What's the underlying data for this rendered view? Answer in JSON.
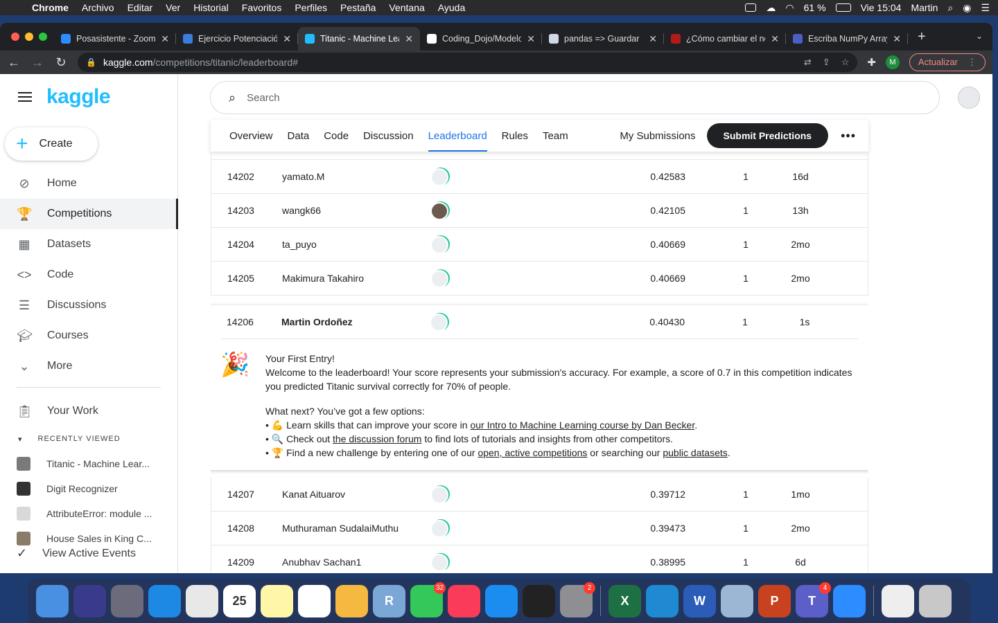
{
  "menubar": {
    "app": "Chrome",
    "items": [
      "Archivo",
      "Editar",
      "Ver",
      "Historial",
      "Favoritos",
      "Perfiles",
      "Pestaña",
      "Ventana",
      "Ayuda"
    ],
    "battery": "61 %",
    "clock": "Vie 15:04",
    "user": "Martin"
  },
  "browser": {
    "tabs": [
      {
        "title": "Posasistente - Zoom",
        "color": "#2d8cff"
      },
      {
        "title": "Ejercicio Potenciación",
        "color": "#3b7ddd"
      },
      {
        "title": "Titanic - Machine Learning",
        "color": "#20beff"
      },
      {
        "title": "Coding_Dojo/Modelos",
        "color": "#ffffff"
      },
      {
        "title": "pandas => Guardar",
        "color": "#d0d7e5"
      },
      {
        "title": "¿Cómo cambiar el nombre",
        "color": "#b31b1b"
      },
      {
        "title": "Escriba NumPy Array",
        "color": "#4a5fc1"
      }
    ],
    "active_tab": 2,
    "url_host": "kaggle.com",
    "url_path": "/competitions/titanic/leaderboard#",
    "profile_initial": "M",
    "update_label": "Actualizar"
  },
  "sidebar": {
    "logo": "kaggle",
    "create": "Create",
    "nav": [
      {
        "label": "Home",
        "icon": "compass-icon"
      },
      {
        "label": "Competitions",
        "icon": "trophy-icon"
      },
      {
        "label": "Datasets",
        "icon": "table-icon"
      },
      {
        "label": "Code",
        "icon": "code-icon"
      },
      {
        "label": "Discussions",
        "icon": "comments-icon"
      },
      {
        "label": "Courses",
        "icon": "school-icon"
      },
      {
        "label": "More",
        "icon": "chevron-down-icon"
      }
    ],
    "your_work": "Your Work",
    "recently_viewed": "RECENTLY VIEWED",
    "recent": [
      {
        "label": "Titanic - Machine Lear...",
        "color": "#7a7a7a"
      },
      {
        "label": "Digit Recognizer",
        "color": "#333333"
      },
      {
        "label": "AttributeError: module ...",
        "color": "#d9d9d9"
      },
      {
        "label": "House Sales in King C...",
        "color": "#8a7b6a"
      }
    ],
    "view_active_events": "View Active Events"
  },
  "main": {
    "search_placeholder": "Search",
    "tabs": [
      "Overview",
      "Data",
      "Code",
      "Discussion",
      "Leaderboard",
      "Rules",
      "Team"
    ],
    "active_tab": "Leaderboard",
    "my_submissions": "My Submissions",
    "submit": "Submit Predictions",
    "rows_before": [
      {
        "rank": "14202",
        "name": "yamato.M",
        "score": "0.42583",
        "entries": "1",
        "last": "16d",
        "photo": false
      },
      {
        "rank": "14203",
        "name": "wangk66",
        "score": "0.42105",
        "entries": "1",
        "last": "13h",
        "photo": true
      },
      {
        "rank": "14204",
        "name": "ta_puyo",
        "score": "0.40669",
        "entries": "1",
        "last": "2mo",
        "photo": false
      },
      {
        "rank": "14205",
        "name": "Makimura Takahiro",
        "score": "0.40669",
        "entries": "1",
        "last": "2mo",
        "photo": false
      }
    ],
    "you": {
      "rank": "14206",
      "name": "Martin Ordoñez",
      "score": "0.40430",
      "entries": "1",
      "last": "1s",
      "title": "Your First Entry!",
      "welcome": "Welcome to the leaderboard! Your score represents your submission's accuracy. For example, a score of 0.7 in this competition indicates you predicted Titanic survival correctly for 70% of people.",
      "what_next": "What next? You’ve got a few options:",
      "opt1_pre": "💪 Learn skills that can improve your score in ",
      "opt1_link": "our Intro to Machine Learning course by Dan Becker",
      "opt1_post": ".",
      "opt2_pre": "🔍 Check out ",
      "opt2_link": "the discussion forum",
      "opt2_post": " to find lots of tutorials and insights from other competitors.",
      "opt3_pre": "🏆 Find a new challenge by entering one of our ",
      "opt3_link1": "open, active competitions",
      "opt3_mid": " or searching our ",
      "opt3_link2": "public datasets",
      "opt3_post": "."
    },
    "rows_after": [
      {
        "rank": "14207",
        "name": "Kanat Aituarov",
        "score": "0.39712",
        "entries": "1",
        "last": "1mo"
      },
      {
        "rank": "14208",
        "name": "Muthuraman SudalaiMuthu",
        "score": "0.39473",
        "entries": "1",
        "last": "2mo"
      },
      {
        "rank": "14209",
        "name": "Anubhav Sachan1",
        "score": "0.38995",
        "entries": "1",
        "last": "6d"
      }
    ]
  },
  "dock": {
    "apps": [
      {
        "name": "finder",
        "color": "#4a90e2",
        "label": "",
        "badge": ""
      },
      {
        "name": "siri",
        "color": "#3a3a8a",
        "label": "",
        "badge": ""
      },
      {
        "name": "launchpad",
        "color": "#6b6b7b",
        "label": "",
        "badge": ""
      },
      {
        "name": "safari",
        "color": "#1e88e5",
        "label": "",
        "badge": ""
      },
      {
        "name": "chrome",
        "color": "#e8e8e8",
        "label": "",
        "badge": ""
      },
      {
        "name": "calendar",
        "color": "#ffffff",
        "label": "25",
        "badge": ""
      },
      {
        "name": "notes",
        "color": "#fff6a8",
        "label": "",
        "badge": ""
      },
      {
        "name": "reminders",
        "color": "#ffffff",
        "label": "",
        "badge": ""
      },
      {
        "name": "photos",
        "color": "#f5b942",
        "label": "",
        "badge": ""
      },
      {
        "name": "r",
        "color": "#7aa7d6",
        "label": "R",
        "badge": ""
      },
      {
        "name": "facetime",
        "color": "#34c759",
        "label": "",
        "badge": "32"
      },
      {
        "name": "music",
        "color": "#fa3c5a",
        "label": "",
        "badge": ""
      },
      {
        "name": "app-store",
        "color": "#1b8cf0",
        "label": "",
        "badge": ""
      },
      {
        "name": "quicktime",
        "color": "#222222",
        "label": "",
        "badge": ""
      },
      {
        "name": "system-preferences",
        "color": "#8e8e93",
        "label": "",
        "badge": "2"
      },
      {
        "name": "excel",
        "color": "#1d7044",
        "label": "X",
        "badge": ""
      },
      {
        "name": "vscode",
        "color": "#1f8ad2",
        "label": "",
        "badge": ""
      },
      {
        "name": "word",
        "color": "#2b5cb8",
        "label": "W",
        "badge": ""
      },
      {
        "name": "preview",
        "color": "#9bb7d4",
        "label": "",
        "badge": ""
      },
      {
        "name": "powerpoint",
        "color": "#c8421f",
        "label": "P",
        "badge": ""
      },
      {
        "name": "teams",
        "color": "#5b5fc7",
        "label": "T",
        "badge": "4"
      },
      {
        "name": "zoom",
        "color": "#2d8cff",
        "label": "",
        "badge": ""
      },
      {
        "name": "documents",
        "color": "#eeeeee",
        "label": "",
        "badge": ""
      },
      {
        "name": "trash",
        "color": "#c8c8c8",
        "label": "",
        "badge": ""
      }
    ]
  }
}
